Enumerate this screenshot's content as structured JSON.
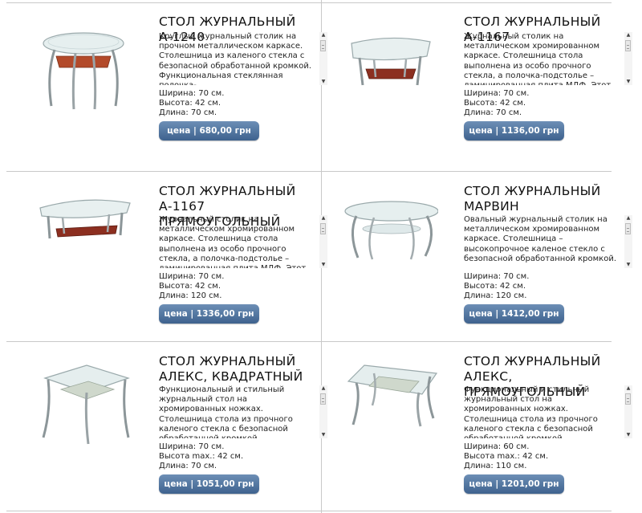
{
  "colors": {
    "button_bg": "#4d71a0",
    "button_text": "#ffffff",
    "divider": "#c8c8c8"
  },
  "products": [
    {
      "title": "СТОЛ ЖУРНАЛЬНЫЙ А-1240",
      "description": "Круглый журнальный столик на прочном металлическом каркасе. Столешница из каленого стекла с безопасной обработанной кромкой. Функциональная стеклянная полочка-",
      "width": "Ширина: 70 см.",
      "height": "Высота: 42 см.",
      "length": "Длина: 70 см.",
      "price": "цена | 680,00 грн",
      "image_icon": "round-glass-table-icon"
    },
    {
      "title": "СТОЛ ЖУРНАЛЬНЫЙ А-1167",
      "description": "Журнальный столик на металлическом хромированном каркасе. Столешница стола выполнена из особо прочного стекла, а полочка-подстолье – ламинированная плита МДФ. Этот стол",
      "width": "Ширина: 70 см.",
      "height": "Высота: 42 см.",
      "length": "Длина: 70 см.",
      "price": "цена | 1136,00 грн",
      "image_icon": "square-glass-table-icon"
    },
    {
      "title": "СТОЛ ЖУРНАЛЬНЫЙ А-1167 ПРЯМОУГОЛЬНЫЙ",
      "description": "Журнальный столик на металлическом хромированном каркасе. Столешница стола выполнена из особо прочного стекла, а полочка-подстолье – ламинированная плита МДФ. Этот стол",
      "width": "Ширина: 70 см.",
      "height": "Высота: 42 см.",
      "length": "Длина: 120 см.",
      "price": "цена | 1336,00 грн",
      "image_icon": "rectangular-glass-table-icon"
    },
    {
      "title": "СТОЛ ЖУРНАЛЬНЫЙ МАРВИН",
      "description": "Овальный журнальный столик на металлическом хромированном каркасе. Столешница – высокопрочное каленое стекло с безопасной обработанной кромкой.",
      "width": "Ширина: 70 см.",
      "height": "Высота: 42 см.",
      "length": "Длина: 120 см.",
      "price": "цена | 1412,00 грн",
      "image_icon": "oval-glass-table-icon"
    },
    {
      "title": "СТОЛ ЖУРНАЛЬНЫЙ АЛЕКС, КВАДРАТНЫЙ",
      "description": "Функциональный и стильный журнальный стол на хромированных ножках. Столешница стола из прочного каленого стекла с безопасной обработанной кромкой.",
      "width": "Ширина: 70 см.",
      "height": "Высота max.: 42 см.",
      "length": "Длина: 70 см.",
      "price": "цена | 1051,00 грн",
      "image_icon": "square-glass-table-icon"
    },
    {
      "title": "СТОЛ ЖУРНАЛЬНЫЙ АЛЕКС, ПРЯМОУГОЛЬНЫЙ",
      "description": "Функциональный и стильный журнальный стол на хромированных ножках. Столешница стола из прочного каленого стекла с безопасной обработанной кромкой.",
      "width": "Ширина: 60 см.",
      "height": "Высота max.: 42 см.",
      "length": "Длина: 110 см.",
      "price": "цена | 1201,00 грн",
      "image_icon": "rectangular-glass-table-icon"
    }
  ]
}
